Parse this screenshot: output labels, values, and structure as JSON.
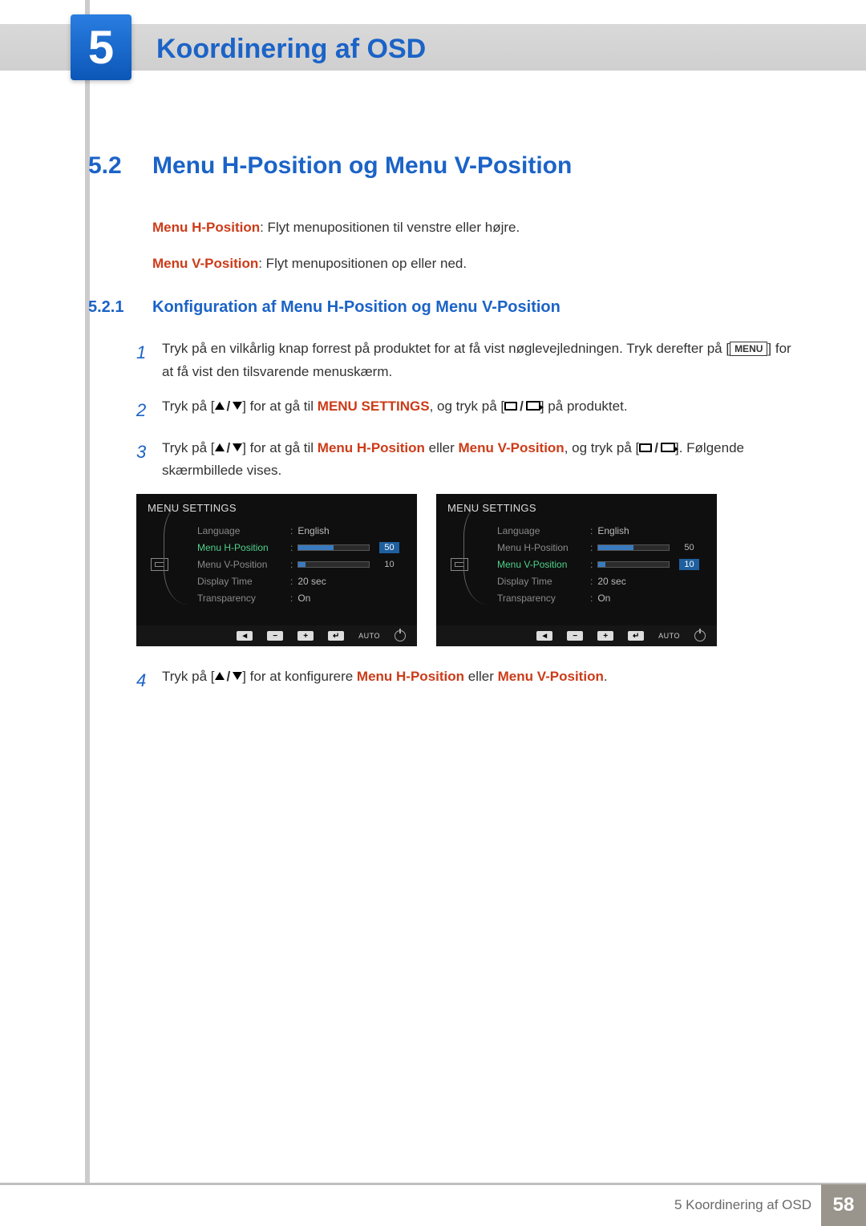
{
  "chapter": {
    "number": "5",
    "title": "Koordinering af OSD"
  },
  "section": {
    "number": "5.2",
    "title": "Menu H-Position og Menu V-Position"
  },
  "intro": {
    "h_label": "Menu H-Position",
    "h_text": ": Flyt menupositionen til venstre eller højre.",
    "v_label": "Menu V-Position",
    "v_text": ": Flyt menupositionen op eller ned."
  },
  "subsection": {
    "number": "5.2.1",
    "title": "Konfiguration af Menu H-Position og Menu V-Position"
  },
  "steps": {
    "s1_a": "Tryk på en vilkårlig knap forrest på produktet for at få vist nøglevejledningen. Tryk derefter på [",
    "s1_menu": "MENU",
    "s1_b": "] for at få vist den tilsvarende menuskærm.",
    "s2_a": "Tryk på [",
    "s2_b": "] for at gå til ",
    "s2_target": "MENU SETTINGS",
    "s2_c": ", og tryk på [",
    "s2_d": "] på produktet.",
    "s3_a": "Tryk på [",
    "s3_b": "] for at gå til ",
    "s3_t1": "Menu H-Position",
    "s3_mid": " eller ",
    "s3_t2": "Menu V-Position",
    "s3_c": ", og tryk på [",
    "s3_d": "]. Følgende skærmbillede vises.",
    "s4_a": "Tryk på [",
    "s4_b": "] for at konfigurere ",
    "s4_t1": "Menu H-Position",
    "s4_mid": " eller ",
    "s4_t2": "Menu V-Position",
    "s4_end": "."
  },
  "osd": {
    "title": "MENU SETTINGS",
    "rows": {
      "language_label": "Language",
      "language_val": "English",
      "h_label": "Menu H-Position",
      "h_val": "50",
      "v_label": "Menu V-Position",
      "v_val": "10",
      "display_label": "Display Time",
      "display_val": "20 sec",
      "transp_label": "Transparency",
      "transp_val": "On"
    },
    "buttons": {
      "auto": "AUTO",
      "back": "◄",
      "minus": "−",
      "plus": "+",
      "enter": "↵"
    }
  },
  "footer": {
    "text": "5 Koordinering af OSD",
    "page": "58"
  }
}
